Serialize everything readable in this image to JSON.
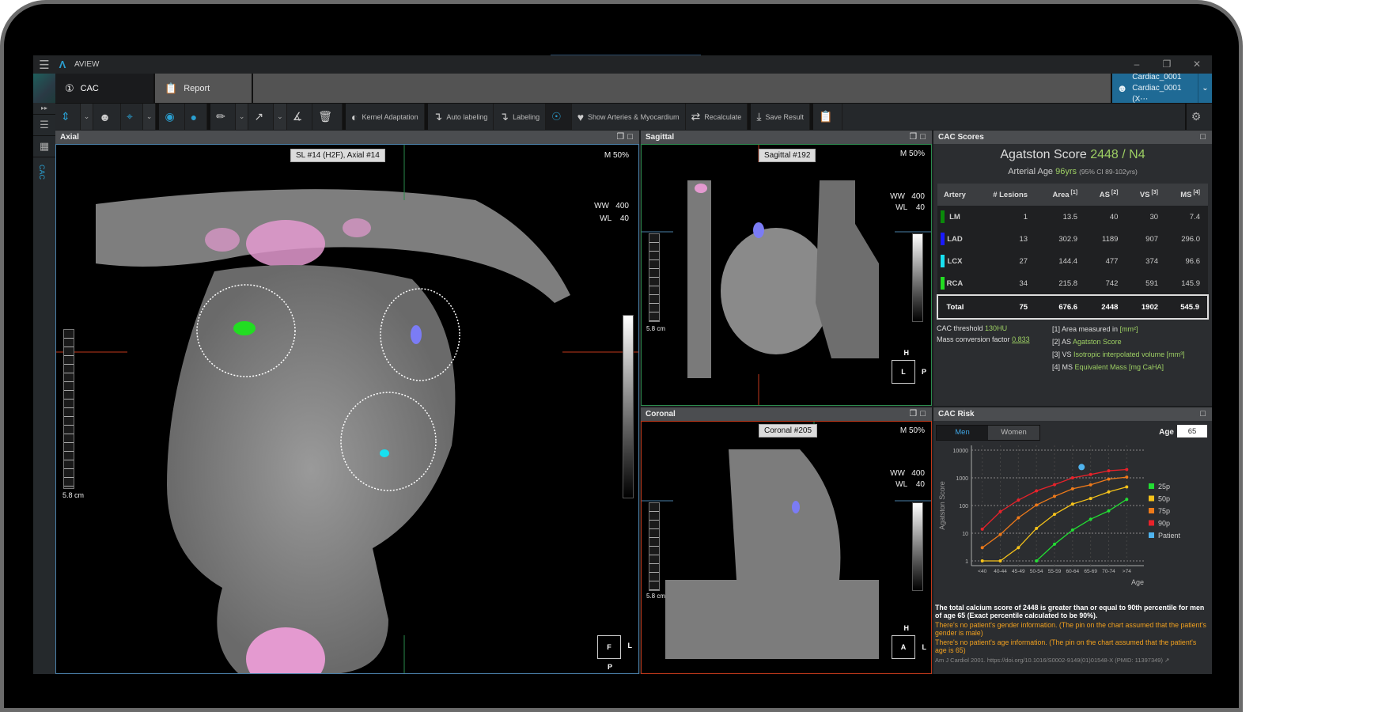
{
  "app": {
    "name": "AVIEW",
    "window_controls": [
      "minimize",
      "restore",
      "close"
    ]
  },
  "tabs": [
    {
      "label": "CAC",
      "icon": "step-1-icon",
      "active": true
    },
    {
      "label": "Report",
      "icon": "clipboard-icon",
      "active": false
    }
  ],
  "patient": {
    "line1": "Cardiac_0001",
    "line2": "Cardiac_0001 (X⋯"
  },
  "sidebar": {
    "vertical_label": "CAC"
  },
  "toolbar": {
    "kernel_adaptation": "Kernel Adaptation",
    "auto_labeling": "Auto labeling",
    "labeling": "Labeling",
    "show_arteries": "Show Arteries & Myocardium",
    "recalculate": "Recalculate",
    "save_result": "Save Result"
  },
  "viewports": {
    "axial": {
      "title": "Axial",
      "slice_label": "SL #14 (H2F), Axial #14",
      "magnification": "M 50%",
      "ww": "WW   400",
      "wl": "WL    40",
      "scale": "5.8 cm",
      "orient_center": "F",
      "orient_right": "L",
      "orient_bottom": "P"
    },
    "sagittal": {
      "title": "Sagittal",
      "slice_label": "Sagittal #192",
      "magnification": "M 50%",
      "ww": "WW   400",
      "wl": "WL    40",
      "scale": "5.8 cm",
      "orient_top": "H",
      "orient_center": "L",
      "orient_right": "P"
    },
    "coronal": {
      "title": "Coronal",
      "slice_label": "Coronal #205",
      "magnification": "M 50%",
      "ww": "WW   400",
      "wl": "WL    40",
      "scale": "5.8 cm",
      "orient_top": "H",
      "orient_center": "A",
      "orient_right": "L"
    }
  },
  "cac_scores": {
    "title": "CAC Scores",
    "agatston_label": "Agatston Score",
    "agatston_value": "2448 / N4",
    "arterial_age_label": "Arterial Age",
    "arterial_age_value": "96yrs",
    "arterial_age_ci": "(95% CI 89-102yrs)",
    "columns": [
      "Artery",
      "# Lesions",
      "Area",
      "AS",
      "VS",
      "MS"
    ],
    "column_sups": [
      "",
      "",
      "[1]",
      "[2]",
      "[3]",
      "[4]"
    ],
    "rows": [
      {
        "artery": "LM",
        "color": "#0a8a0a",
        "lesions": "1",
        "area": "13.5",
        "as": "40",
        "vs": "30",
        "ms": "7.4"
      },
      {
        "artery": "LAD",
        "color": "#1a1aff",
        "lesions": "13",
        "area": "302.9",
        "as": "1189",
        "vs": "907",
        "ms": "296.0"
      },
      {
        "artery": "LCX",
        "color": "#18e0f0",
        "lesions": "27",
        "area": "144.4",
        "as": "477",
        "vs": "374",
        "ms": "96.6"
      },
      {
        "artery": "RCA",
        "color": "#22dd22",
        "lesions": "34",
        "area": "215.8",
        "as": "742",
        "vs": "591",
        "ms": "145.9"
      }
    ],
    "total": {
      "label": "Total",
      "lesions": "75",
      "area": "676.6",
      "as": "2448",
      "vs": "1902",
      "ms": "545.9"
    },
    "threshold_label": "CAC threshold",
    "threshold_value": "130HU",
    "mass_factor_label": "Mass conversion factor",
    "mass_factor_value": "0.833",
    "notes": [
      {
        "prefix": "[1] Area measured in",
        "value": "[mm²]"
      },
      {
        "prefix": "[2] AS",
        "value": "Agatston Score"
      },
      {
        "prefix": "[3] VS",
        "value": "Isotropic interpolated volume [mm³]"
      },
      {
        "prefix": "[4] MS",
        "value": "Equivalent Mass [mg CaHA]"
      }
    ]
  },
  "cac_risk": {
    "title": "CAC Risk",
    "gender_options": [
      "Men",
      "Women"
    ],
    "gender_selected": "Men",
    "age_label": "Age",
    "age_value": "65",
    "summary": "The total calcium score of 2448 is greater than or equal to 90th percentile for men of age 65 (Exact percentile calculated to be 90%).",
    "warning_gender": "There's no patient's gender information. (The pin on the chart assumed that the patient's gender is male)",
    "warning_age": "There's no patient's age information. (The pin on the chart assumed that the patient's age is 65)",
    "reference": "Am J Cardiol 2001. https://doi.org/10.1016/S0002-9149(01)01548-X (PMID: 11397349)"
  },
  "chart_data": {
    "type": "line",
    "title": "",
    "xlabel": "Age",
    "ylabel": "Agatston Score",
    "yscale": "log",
    "ylim": [
      1,
      10000
    ],
    "yticks": [
      1,
      10,
      100,
      1000,
      10000
    ],
    "categories": [
      "<40",
      "40-44",
      "45-49",
      "50-54",
      "55-59",
      "60-64",
      "65-69",
      "70-74",
      ">74"
    ],
    "grid": true,
    "legend_position": "right",
    "series": [
      {
        "name": "25p",
        "color": "#22dd33",
        "values": [
          null,
          null,
          null,
          1,
          4,
          13,
          32,
          64,
          167
        ]
      },
      {
        "name": "50p",
        "color": "#f5c21a",
        "values": [
          1,
          1,
          3,
          15,
          48,
          113,
          180,
          310,
          470
        ]
      },
      {
        "name": "75p",
        "color": "#ee7a1a",
        "values": [
          3,
          9,
          36,
          104,
          214,
          400,
          560,
          900,
          1060
        ]
      },
      {
        "name": "90p",
        "color": "#e8222a",
        "values": [
          14,
          60,
          157,
          338,
          566,
          1000,
          1318,
          1800,
          2000
        ]
      }
    ],
    "patient": {
      "name": "Patient",
      "color": "#4fb3ee",
      "age": 65,
      "value": 2448
    }
  }
}
